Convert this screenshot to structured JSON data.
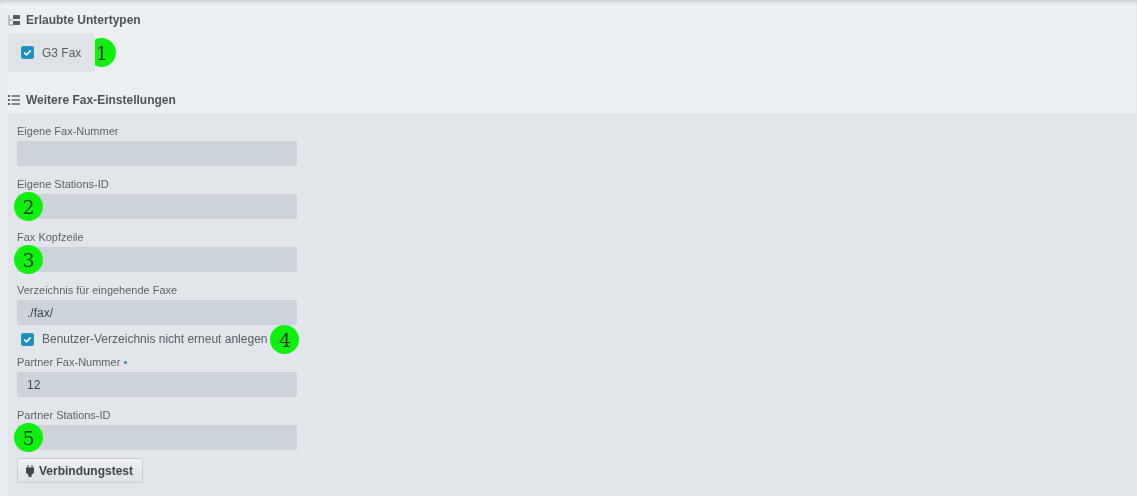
{
  "sections": [
    {
      "title": "Erlaubte Untertypen",
      "items": [
        {
          "kind": "checkbox_card",
          "label": "G3 Fax",
          "checked": true,
          "marker": "1"
        }
      ]
    },
    {
      "title": "Weitere Fax-Einstellungen",
      "items": [
        {
          "kind": "field",
          "label": "Eigene Fax-Nummer"
        },
        {
          "kind": "field",
          "label": "Eigene Stations-ID",
          "marker": "2"
        },
        {
          "kind": "field",
          "label": "Fax Kopfzeile",
          "marker": "3"
        },
        {
          "kind": "field",
          "label": "Verzeichnis für eingehende Faxe",
          "value": "./fax/"
        },
        {
          "kind": "checkbox",
          "label": "Benutzer-Verzeichnis nicht erneut anlegen",
          "checked": true,
          "marker": "4"
        },
        {
          "kind": "field",
          "label": "Partner Fax-Nummer",
          "value": "12",
          "required": true
        },
        {
          "kind": "field",
          "label": "Partner Stations-ID",
          "marker": "5"
        },
        {
          "kind": "button",
          "label": "Verbindungstest"
        }
      ]
    }
  ]
}
